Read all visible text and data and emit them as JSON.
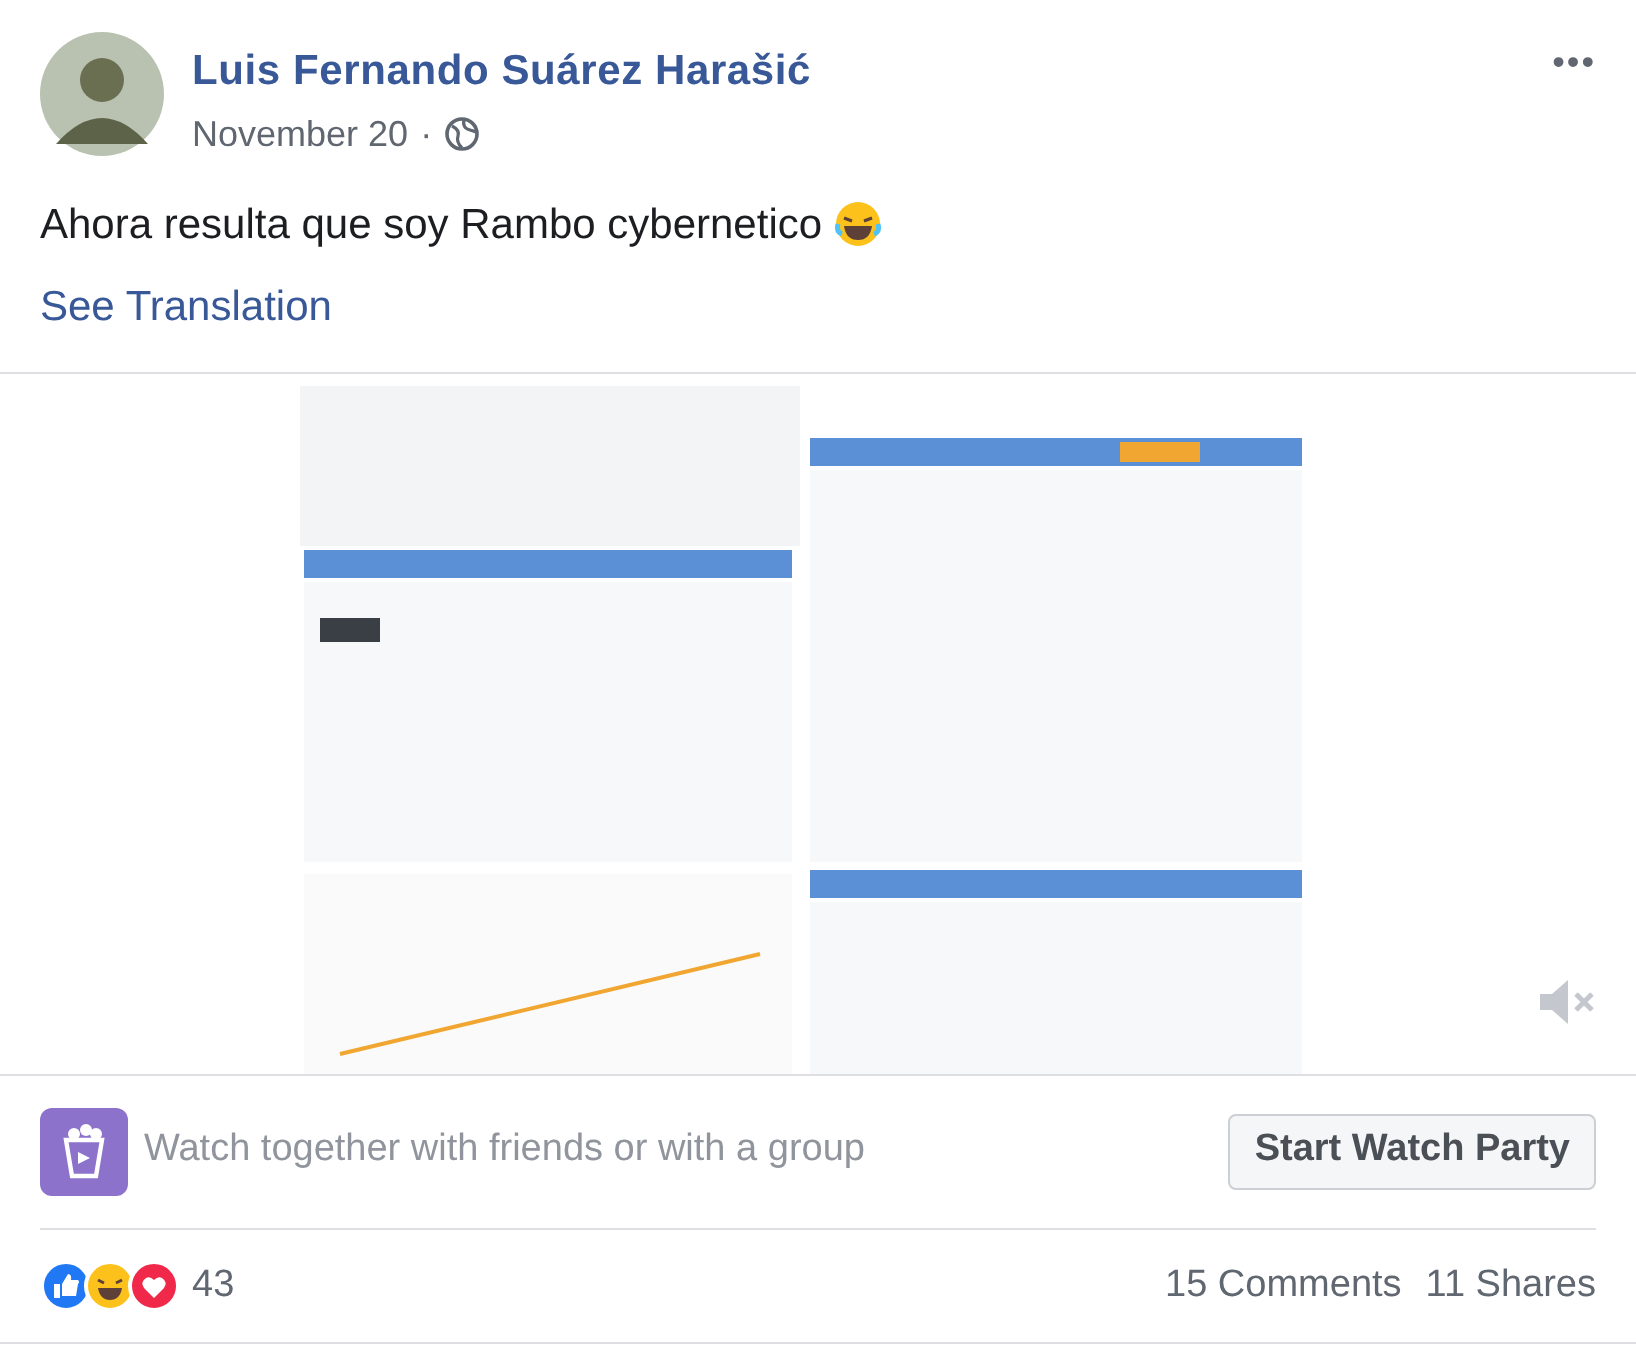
{
  "post": {
    "author": "Luis Fernando Suárez Harašić",
    "date": "November 20",
    "separator": "·",
    "more": "•••",
    "text": "Ahora resulta que soy Rambo cybernetico",
    "translation_link": "See Translation"
  },
  "video": {
    "kind": "picture",
    "muted": true
  },
  "watch_party": {
    "text": "Watch together with friends or with a group",
    "button": "Start Watch Party"
  },
  "footer": {
    "reaction_count": "43",
    "comments": "15 Comments",
    "shares": "11 Shares"
  }
}
